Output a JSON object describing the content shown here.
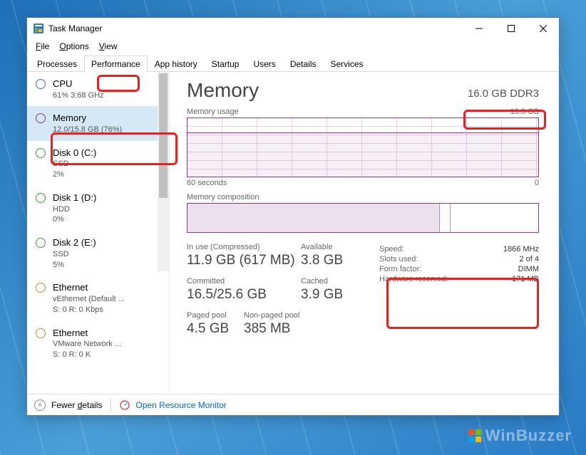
{
  "window": {
    "title": "Task Manager"
  },
  "menu": {
    "file": "File",
    "options": "Options",
    "view": "View"
  },
  "tabs": [
    "Processes",
    "Performance",
    "App history",
    "Startup",
    "Users",
    "Details",
    "Services"
  ],
  "active_tab": 1,
  "sidebar": {
    "items": [
      {
        "title": "CPU",
        "sub": "61% 3.68 GHz",
        "color": "cpu"
      },
      {
        "title": "Memory",
        "sub": "12.0/15.8 GB (76%)",
        "color": "mem"
      },
      {
        "title": "Disk 0 (C:)",
        "sub1": "SSD",
        "sub2": "2%",
        "color": "disk"
      },
      {
        "title": "Disk 1 (D:)",
        "sub1": "HDD",
        "sub2": "0%",
        "color": "disk"
      },
      {
        "title": "Disk 2 (E:)",
        "sub1": "SSD",
        "sub2": "5%",
        "color": "disk"
      },
      {
        "title": "Ethernet",
        "sub1": "vEthernet (Default ...",
        "sub2": "S: 0  R: 0 Kbps",
        "color": "eth"
      },
      {
        "title": "Ethernet",
        "sub1": "VMware Network ...",
        "sub2": "S: 0  R: 0 K",
        "color": "eth"
      }
    ],
    "selected": 1
  },
  "main": {
    "title": "Memory",
    "spec": "16.0 GB DDR3",
    "chart1_label": "Memory usage",
    "chart1_max": "15.8 GB",
    "chart1_xmin": "60 seconds",
    "chart1_xmax": "0",
    "chart2_label": "Memory composition",
    "stats": {
      "inuse_label": "In use (Compressed)",
      "inuse": "11.9 GB (617 MB)",
      "avail_label": "Available",
      "avail": "3.8 GB",
      "committed_label": "Committed",
      "committed": "16.5/25.6 GB",
      "cached_label": "Cached",
      "cached": "3.9 GB",
      "paged_label": "Paged pool",
      "paged": "4.5 GB",
      "nonpaged_label": "Non-paged pool",
      "nonpaged": "385 MB"
    },
    "specs": {
      "speed_l": "Speed:",
      "speed": "1866 MHz",
      "slots_l": "Slots used:",
      "slots": "2 of 4",
      "form_l": "Form factor:",
      "form": "DIMM",
      "hw_l": "Hardware reserved:",
      "hw": "171 MB"
    }
  },
  "footer": {
    "fewer": "Fewer details",
    "monitor": "Open Resource Monitor"
  },
  "chart_data": {
    "type": "line",
    "title": "Memory usage",
    "x_range_seconds": [
      60,
      0
    ],
    "y_range_gb": [
      0,
      15.8
    ],
    "approx_usage_gb": 12.0,
    "composition_pct": {
      "in_use": 72,
      "modified": 3,
      "standby_free": 25
    }
  }
}
